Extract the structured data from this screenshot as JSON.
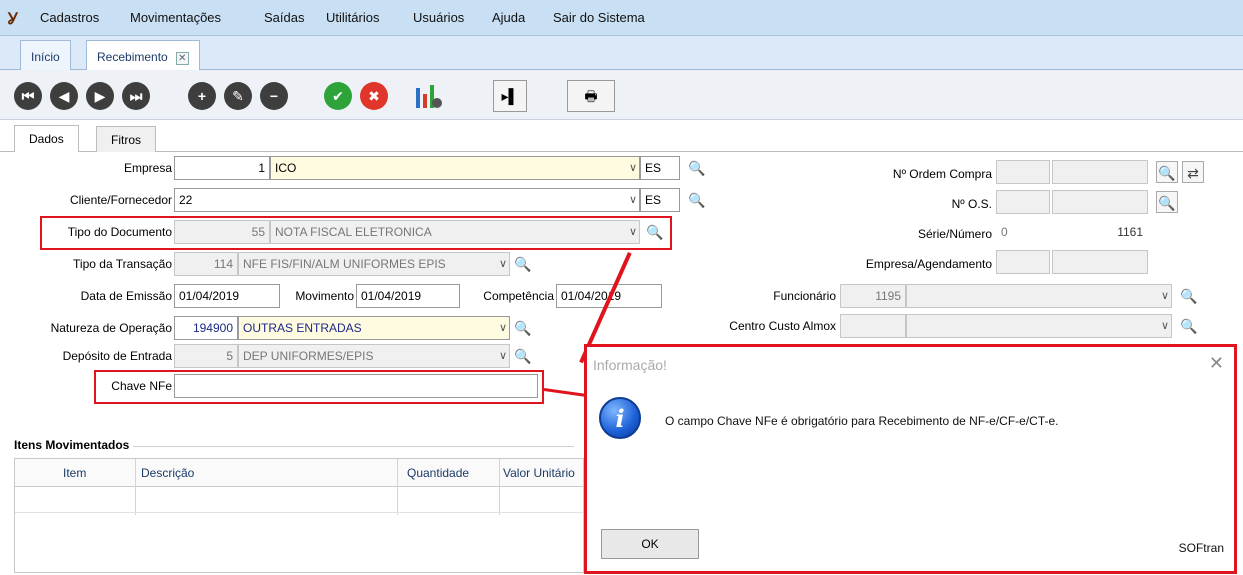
{
  "menu": {
    "items": [
      {
        "label": "Cadastros",
        "ul": "C"
      },
      {
        "label": "Movimentações",
        "ul": "M"
      },
      {
        "label": "Saídas",
        "ul": "S"
      },
      {
        "label": "Utilitários",
        "ul": "U"
      },
      {
        "label": "Usuários",
        "ul": "r"
      },
      {
        "label": "Ajuda",
        "ul": "A"
      },
      {
        "label": "Sair do Sistema",
        "ul": "i"
      }
    ]
  },
  "doc_tabs": [
    {
      "label": "Início"
    },
    {
      "label": "Recebimento"
    }
  ],
  "sub_tabs": [
    {
      "label": "Dados"
    },
    {
      "label": "Fitros"
    }
  ],
  "form": {
    "empresa": {
      "label": "Empresa",
      "code": "1",
      "name": "ICO",
      "uf": "ES"
    },
    "cliente": {
      "label": "Cliente/Fornecedor",
      "code": "22",
      "uf": "ES"
    },
    "tipo_documento": {
      "label": "Tipo do Documento",
      "code": "55",
      "name": "NOTA FISCAL ELETRONICA"
    },
    "tipo_transacao": {
      "label": "Tipo da Transação",
      "code": "114",
      "name": "NFE FIS/FIN/ALM UNIFORMES EPIS"
    },
    "data_emissao": {
      "label": "Data de Emissão",
      "value": "01/04/2019"
    },
    "movimento": {
      "label": "Movimento",
      "value": "01/04/2019"
    },
    "competencia": {
      "label": "Competência",
      "value": "01/04/2019"
    },
    "natureza": {
      "label": "Natureza de Operação",
      "code": "194900",
      "name": "OUTRAS ENTRADAS"
    },
    "deposito": {
      "label": "Depósito de Entrada",
      "code": "5",
      "name": "DEP UNIFORMES/EPIS"
    },
    "chave": {
      "label": "Chave NFe",
      "value": ""
    },
    "ordem_compra": {
      "label": "Nº Ordem Compra"
    },
    "os": {
      "label": "Nº O.S."
    },
    "serie_numero": {
      "label": "Série/Número",
      "serie": "0",
      "numero": "1161"
    },
    "agendamento": {
      "label": "Empresa/Agendamento"
    },
    "funcionario": {
      "label": "Funcionário",
      "code": "1195"
    },
    "centro_custo": {
      "label": "Centro Custo Almox"
    }
  },
  "items_group": {
    "title": "Itens Movimentados",
    "columns": [
      "Item",
      "Descrição",
      "Quantidade",
      "Valor Unitário"
    ]
  },
  "dialog": {
    "title": "Informação!",
    "message": "O campo Chave NFe é obrigatório para Recebimento de NF-e/CF-e/CT-e.",
    "ok_label": "OK",
    "brand": "SOFtran"
  },
  "colors": {
    "highlight_red": "#e0141e",
    "menubar": "#c9dff4",
    "green_action": "#2ea33a",
    "red_action": "#e0352b"
  }
}
